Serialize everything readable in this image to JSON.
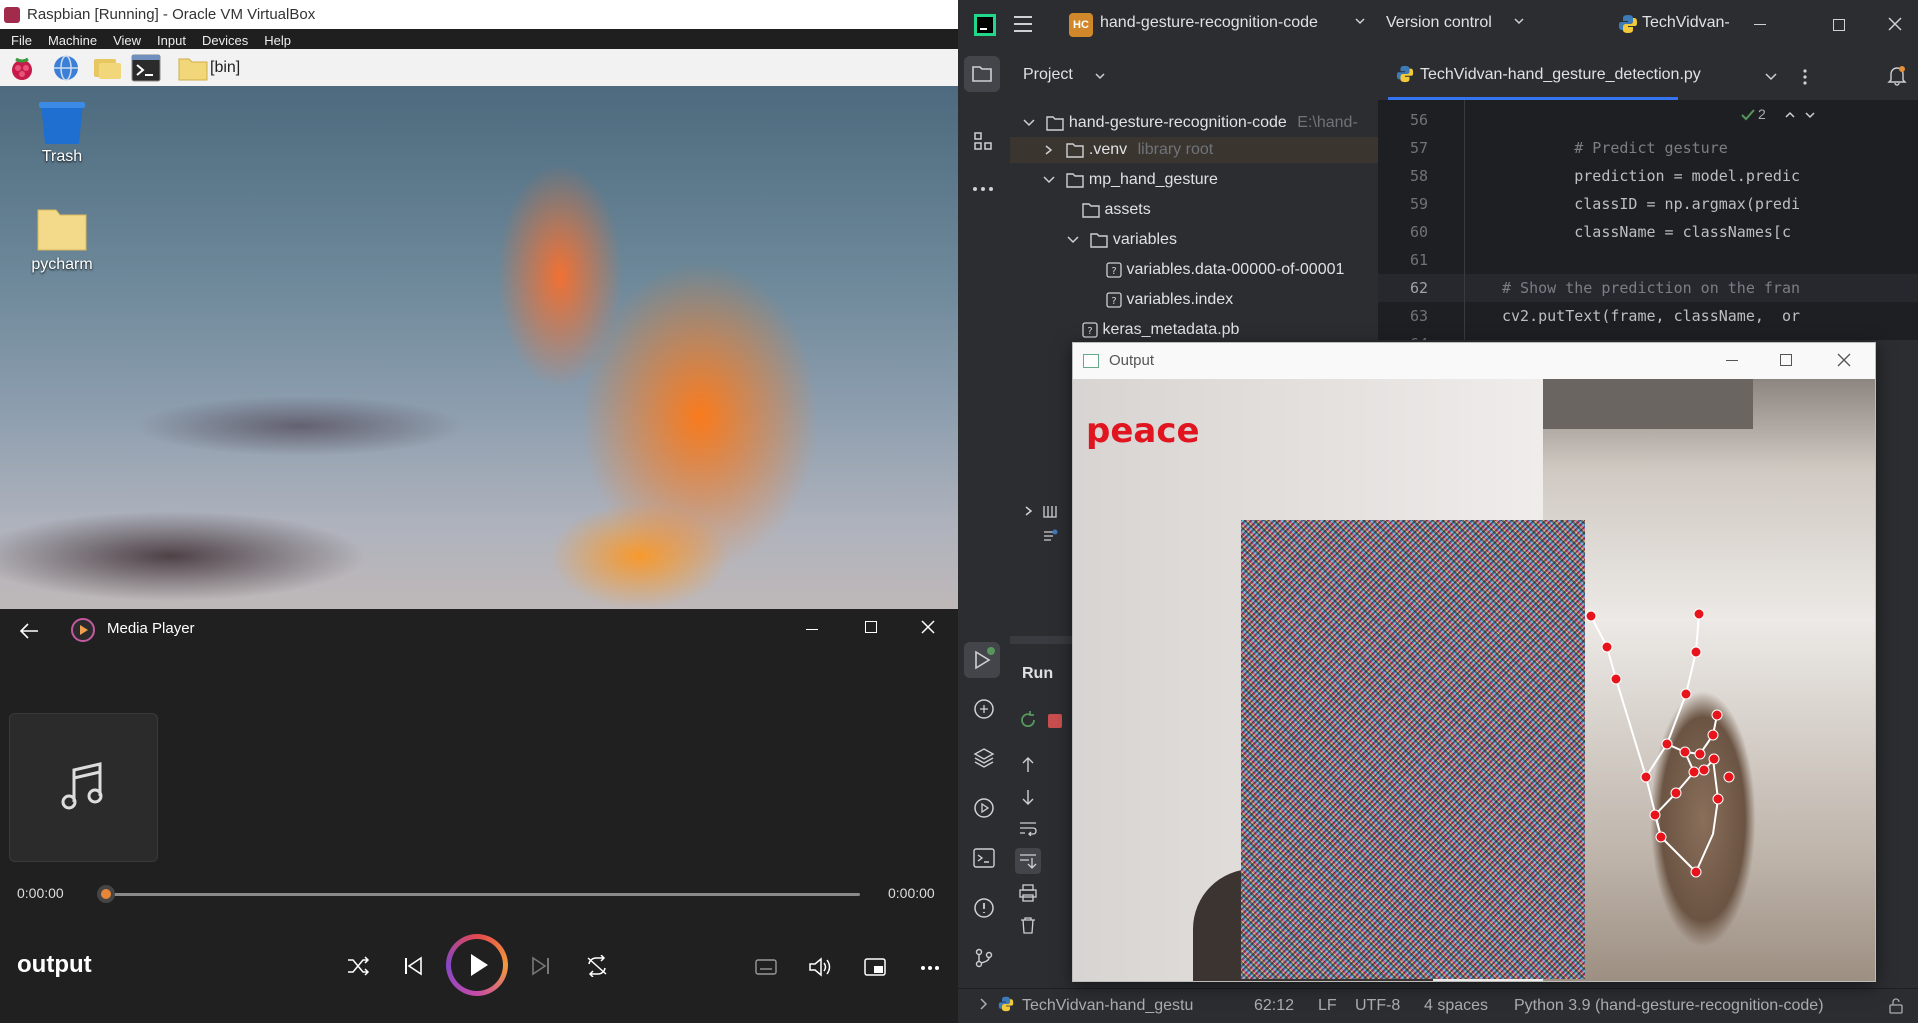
{
  "virtualbox": {
    "window_title": "Raspbian [Running] - Oracle VM VirtualBox",
    "menu": [
      "File",
      "Machine",
      "View",
      "Input",
      "Devices",
      "Help"
    ],
    "taskbar_folder_label": "[bin]",
    "desktop_icons": [
      {
        "label": "Trash",
        "icon": "trash-icon"
      },
      {
        "label": "pycharm",
        "icon": "folder-icon"
      }
    ]
  },
  "media_player": {
    "app_title": "Media Player",
    "time_elapsed": "0:00:00",
    "time_total": "0:00:00",
    "track_name": "output",
    "progress": 0,
    "accent": "#e88638"
  },
  "pycharm": {
    "project_badge": "HC",
    "project_name": "hand-gesture-recognition-code",
    "vcs": "Version control",
    "run_config": "TechVidvan-",
    "panel_title": "Project",
    "tree": [
      {
        "label": "hand-gesture-recognition-code",
        "suffix": "E:\\hand-",
        "level": 0,
        "kind": "folder",
        "expanded": true
      },
      {
        "label": ".venv",
        "suffix": "library root",
        "level": 1,
        "kind": "folder",
        "expanded": false
      },
      {
        "label": "mp_hand_gesture",
        "suffix": "",
        "level": 1,
        "kind": "folder",
        "expanded": true
      },
      {
        "label": "assets",
        "suffix": "",
        "level": 2,
        "kind": "folder",
        "expanded": null
      },
      {
        "label": "variables",
        "suffix": "",
        "level": 2,
        "kind": "folder",
        "expanded": true
      },
      {
        "label": "variables.data-00000-of-00001",
        "suffix": "",
        "level": 3,
        "kind": "file",
        "expanded": null
      },
      {
        "label": "variables.index",
        "suffix": "",
        "level": 3,
        "kind": "file",
        "expanded": null
      },
      {
        "label": "keras_metadata.pb",
        "suffix": "",
        "level": 2,
        "kind": "file",
        "expanded": null
      }
    ],
    "editor_tab": "TechVidvan-hand_gesture_detection.py",
    "inspection_count": "2",
    "code_lines": [
      {
        "n": "56",
        "text": ""
      },
      {
        "n": "57",
        "text": "        # Predict gesture"
      },
      {
        "n": "58",
        "text": "        prediction = model.predic"
      },
      {
        "n": "59",
        "text": "        classID = np.argmax(predi"
      },
      {
        "n": "60",
        "text": "        className = classNames[c"
      },
      {
        "n": "61",
        "text": ""
      },
      {
        "n": "62",
        "text": "# Show the prediction on the fran"
      },
      {
        "n": "63",
        "text": "cv2.putText(frame, className,  or"
      },
      {
        "n": "64",
        "text": ""
      }
    ],
    "current_line": "62",
    "run_panel_title": "Run",
    "status": {
      "file": "TechVidvan-hand_gestu",
      "position": "62:12",
      "line_sep": "LF",
      "encoding": "UTF-8",
      "indent": "4 spaces",
      "interpreter": "Python 3.9 (hand-gesture-recognition-code)"
    }
  },
  "output_window": {
    "title": "Output",
    "prediction_label": "peace",
    "label_color": "#e0151f",
    "landmark_color": "#e8141c"
  }
}
